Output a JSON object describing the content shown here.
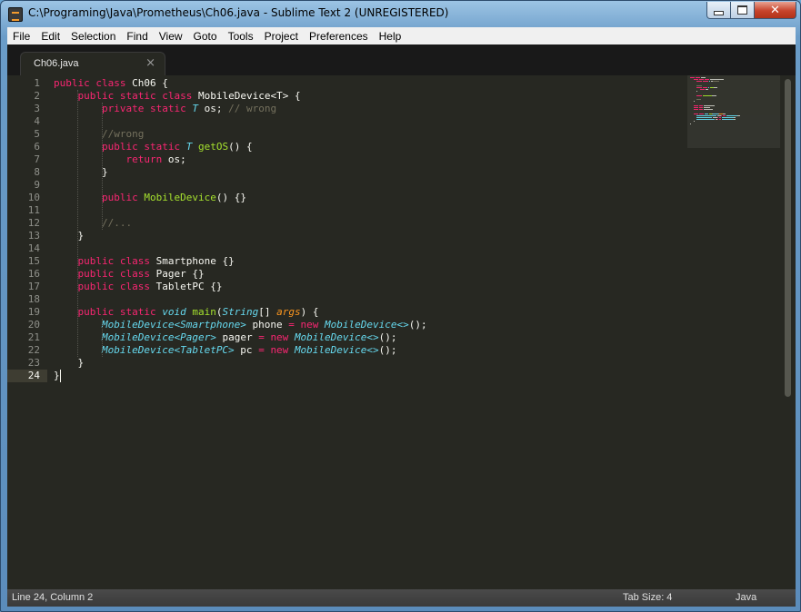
{
  "window": {
    "title": "C:\\Programing\\Java\\Prometheus\\Ch06.java - Sublime Text 2 (UNREGISTERED)",
    "close_glyph": "✕"
  },
  "menu": [
    {
      "label": "File"
    },
    {
      "label": "Edit"
    },
    {
      "label": "Selection"
    },
    {
      "label": "Find"
    },
    {
      "label": "View"
    },
    {
      "label": "Goto"
    },
    {
      "label": "Tools"
    },
    {
      "label": "Project"
    },
    {
      "label": "Preferences"
    },
    {
      "label": "Help"
    }
  ],
  "tab": {
    "label": "Ch06.java",
    "close": "×"
  },
  "editor": {
    "active_line": 24,
    "lines": [
      [
        [
          "kw",
          "public"
        ],
        [
          "p",
          " "
        ],
        [
          "kw",
          "class"
        ],
        [
          "p",
          " Ch06 {"
        ]
      ],
      [
        [
          "p",
          "    "
        ],
        [
          "kw",
          "public"
        ],
        [
          "p",
          " "
        ],
        [
          "kw",
          "static"
        ],
        [
          "p",
          " "
        ],
        [
          "kw",
          "class"
        ],
        [
          "p",
          " MobileDevice<T> {"
        ]
      ],
      [
        [
          "p",
          "        "
        ],
        [
          "kw",
          "private"
        ],
        [
          "p",
          " "
        ],
        [
          "kw",
          "static"
        ],
        [
          "p",
          " "
        ],
        [
          "st",
          "T"
        ],
        [
          "p",
          " os; "
        ],
        [
          "cm",
          "// wrong"
        ]
      ],
      [
        [
          "p",
          ""
        ]
      ],
      [
        [
          "p",
          "        "
        ],
        [
          "cm",
          "//wrong"
        ]
      ],
      [
        [
          "p",
          "        "
        ],
        [
          "kw",
          "public"
        ],
        [
          "p",
          " "
        ],
        [
          "kw",
          "static"
        ],
        [
          "p",
          " "
        ],
        [
          "st",
          "T"
        ],
        [
          "p",
          " "
        ],
        [
          "fn",
          "getOS"
        ],
        [
          "p",
          "() {"
        ]
      ],
      [
        [
          "p",
          "            "
        ],
        [
          "kw",
          "return"
        ],
        [
          "p",
          " os;"
        ]
      ],
      [
        [
          "p",
          "        }"
        ]
      ],
      [
        [
          "p",
          ""
        ]
      ],
      [
        [
          "p",
          "        "
        ],
        [
          "kw",
          "public"
        ],
        [
          "p",
          " "
        ],
        [
          "fn",
          "MobileDevice"
        ],
        [
          "p",
          "() {}"
        ]
      ],
      [
        [
          "p",
          ""
        ]
      ],
      [
        [
          "p",
          "        "
        ],
        [
          "cm",
          "//..."
        ]
      ],
      [
        [
          "p",
          "    }"
        ]
      ],
      [
        [
          "p",
          ""
        ]
      ],
      [
        [
          "p",
          "    "
        ],
        [
          "kw",
          "public"
        ],
        [
          "p",
          " "
        ],
        [
          "kw",
          "class"
        ],
        [
          "p",
          " Smartphone {}"
        ]
      ],
      [
        [
          "p",
          "    "
        ],
        [
          "kw",
          "public"
        ],
        [
          "p",
          " "
        ],
        [
          "kw",
          "class"
        ],
        [
          "p",
          " Pager {}"
        ]
      ],
      [
        [
          "p",
          "    "
        ],
        [
          "kw",
          "public"
        ],
        [
          "p",
          " "
        ],
        [
          "kw",
          "class"
        ],
        [
          "p",
          " TabletPC {}"
        ]
      ],
      [
        [
          "p",
          ""
        ]
      ],
      [
        [
          "p",
          "    "
        ],
        [
          "kw",
          "public"
        ],
        [
          "p",
          " "
        ],
        [
          "kw",
          "static"
        ],
        [
          "p",
          " "
        ],
        [
          "st",
          "void"
        ],
        [
          "p",
          " "
        ],
        [
          "fn",
          "main"
        ],
        [
          "p",
          "("
        ],
        [
          "st",
          "String"
        ],
        [
          "p",
          "[] "
        ],
        [
          "arg",
          "args"
        ],
        [
          "p",
          ") {"
        ]
      ],
      [
        [
          "p",
          "        "
        ],
        [
          "tp",
          "MobileDevice<Smartphone>"
        ],
        [
          "p",
          " phone "
        ],
        [
          "op",
          "="
        ],
        [
          "p",
          " "
        ],
        [
          "op",
          "new"
        ],
        [
          "p",
          " "
        ],
        [
          "tp",
          "MobileDevice<>"
        ],
        [
          "p",
          "();"
        ]
      ],
      [
        [
          "p",
          "        "
        ],
        [
          "tp",
          "MobileDevice<Pager>"
        ],
        [
          "p",
          " pager "
        ],
        [
          "op",
          "="
        ],
        [
          "p",
          " "
        ],
        [
          "op",
          "new"
        ],
        [
          "p",
          " "
        ],
        [
          "tp",
          "MobileDevice<>"
        ],
        [
          "p",
          "();"
        ]
      ],
      [
        [
          "p",
          "        "
        ],
        [
          "tp",
          "MobileDevice<TabletPC>"
        ],
        [
          "p",
          " pc "
        ],
        [
          "op",
          "="
        ],
        [
          "p",
          " "
        ],
        [
          "op",
          "new"
        ],
        [
          "p",
          " "
        ],
        [
          "tp",
          "MobileDevice<>"
        ],
        [
          "p",
          "();"
        ]
      ],
      [
        [
          "p",
          "    }"
        ]
      ],
      [
        [
          "p",
          "}"
        ]
      ]
    ]
  },
  "status": {
    "position": "Line 24, Column 2",
    "tab_size": "Tab Size: 4",
    "syntax": "Java"
  },
  "colors": {
    "background": "#272822",
    "keyword": "#f92672",
    "storage_type": "#66d9ef",
    "function": "#a6e22e",
    "comment": "#75715e",
    "argument": "#fd971f",
    "foreground": "#f8f8f2"
  }
}
